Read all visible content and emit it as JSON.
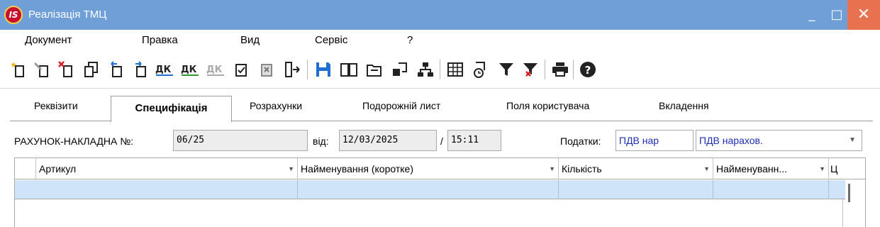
{
  "window": {
    "title": "Реалізація ТМЦ",
    "logo": "IS",
    "controls": {
      "minimize": "_",
      "maximize": "□",
      "close": "✕"
    }
  },
  "menu": [
    "Документ",
    "Правка",
    "Вид",
    "Сервіс",
    "?"
  ],
  "toolbar": {
    "icons": [
      "new-document-icon",
      "edit-document-icon",
      "delete-document-icon",
      "copy-document-icon",
      "move-up-icon",
      "move-down-icon",
      "debit-credit-icon",
      "debit-credit-alt-icon",
      "debit-credit-disabled-icon",
      "post-document-icon",
      "cancel-post-icon",
      "exit-icon",
      "save-icon",
      "book-icon",
      "open-folder-icon",
      "export-icon",
      "hierarchy-icon",
      "table-icon",
      "history-icon",
      "filter-icon",
      "clear-filter-icon",
      "print-icon",
      "help-icon"
    ]
  },
  "tabs": [
    "Реквізити",
    "Специфікація",
    "Розрахунки",
    "Подорожній лист",
    "Поля користувача",
    "Вкладення"
  ],
  "active_tab": "Специфікація",
  "form": {
    "invoice_label": "РАХУНОК-НАКЛАДНА №:",
    "invoice_number": "06/25",
    "date_label": "від:",
    "date": "12/03/2025",
    "time_separator": "/",
    "time": "15:11",
    "taxes_label": "Податки:",
    "tax_code": "ПДВ нар",
    "tax_name": "ПДВ нарахов."
  },
  "grid": {
    "columns": [
      "Артикул",
      "Найменування (коротке)",
      "Кількість",
      "Найменуванн...",
      "Ц"
    ],
    "filter_glyph": "▼"
  },
  "colors": {
    "titlebar": "#6f9fd6",
    "close_button": "#e8714f",
    "selected_row": "#cfe3f9",
    "row_indicator": "#5a96dc",
    "tax_text": "#1f2fb4"
  }
}
